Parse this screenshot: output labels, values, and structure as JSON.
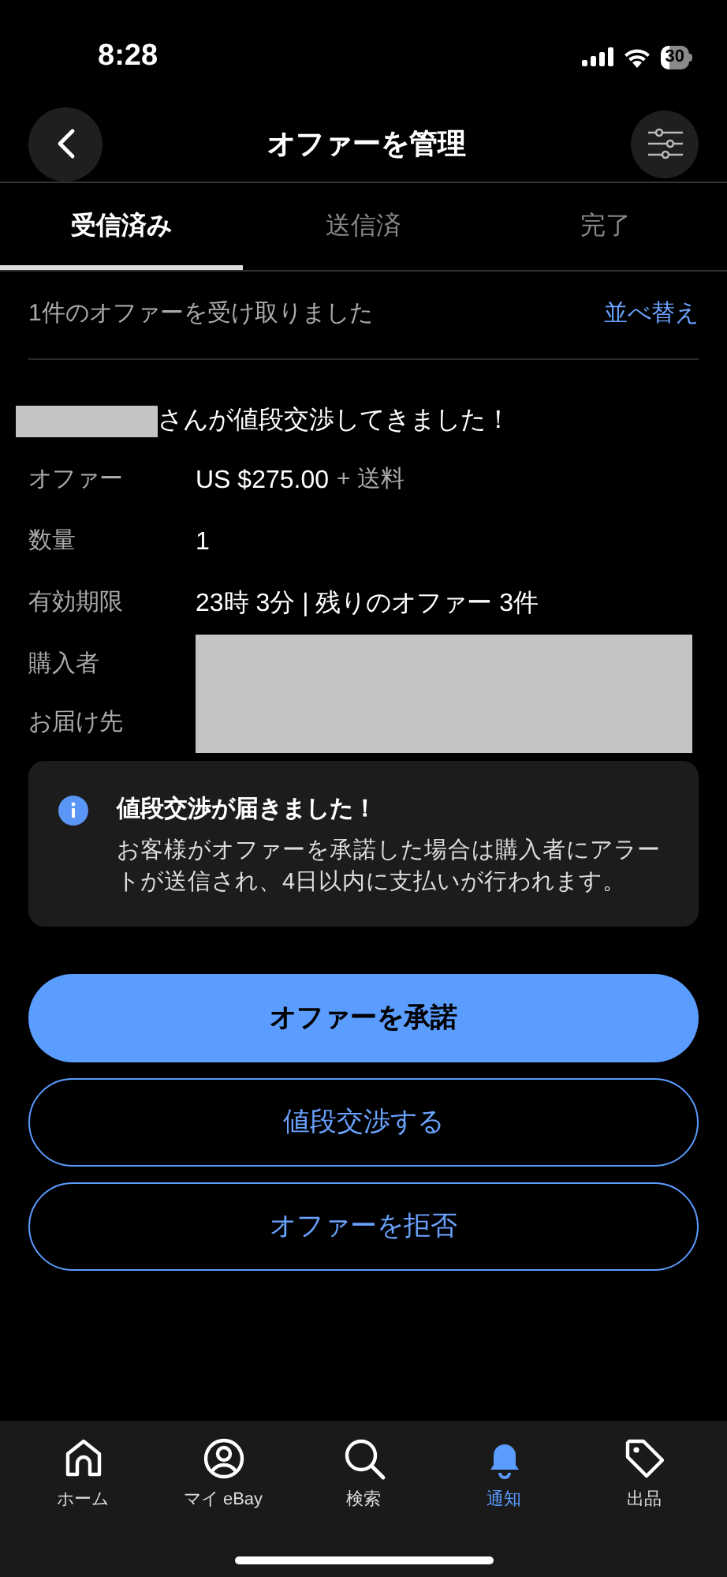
{
  "status_bar": {
    "time": "8:28",
    "battery": "30"
  },
  "header": {
    "title": "オファーを管理"
  },
  "tabs": [
    {
      "label": "受信済み",
      "selected": true
    },
    {
      "label": "送信済",
      "selected": false
    },
    {
      "label": "完了",
      "selected": false
    }
  ],
  "summary": {
    "text": "1件のオファーを受け取りました",
    "sort_label": "並べ替え"
  },
  "offer": {
    "headline": "さんが値段交渉してきました！",
    "details": [
      {
        "label": "オファー",
        "value": "US $275.00",
        "extra": "+ 送料"
      },
      {
        "label": "数量",
        "value": "1"
      },
      {
        "label": "有効期限",
        "value": "23時 3分 | 残りのオファー 3件"
      }
    ],
    "hidden_fields": [
      "購入者",
      "お届け先"
    ]
  },
  "info": {
    "title": "値段交渉が届きました！",
    "body": "お客様がオファーを承諾した場合は購入者にアラートが送信され、4日以内に支払いが行われます。"
  },
  "buttons": [
    {
      "label": "オファーを承諾",
      "kind": "primary"
    },
    {
      "label": "値段交渉する",
      "kind": "outline"
    },
    {
      "label": "オファーを拒否",
      "kind": "outline"
    }
  ],
  "bottom_nav": [
    {
      "label": "ホーム",
      "selected": false
    },
    {
      "label": "マイ eBay",
      "selected": false
    },
    {
      "label": "検索",
      "selected": false
    },
    {
      "label": "通知",
      "selected": true
    },
    {
      "label": "出品",
      "selected": false
    }
  ]
}
